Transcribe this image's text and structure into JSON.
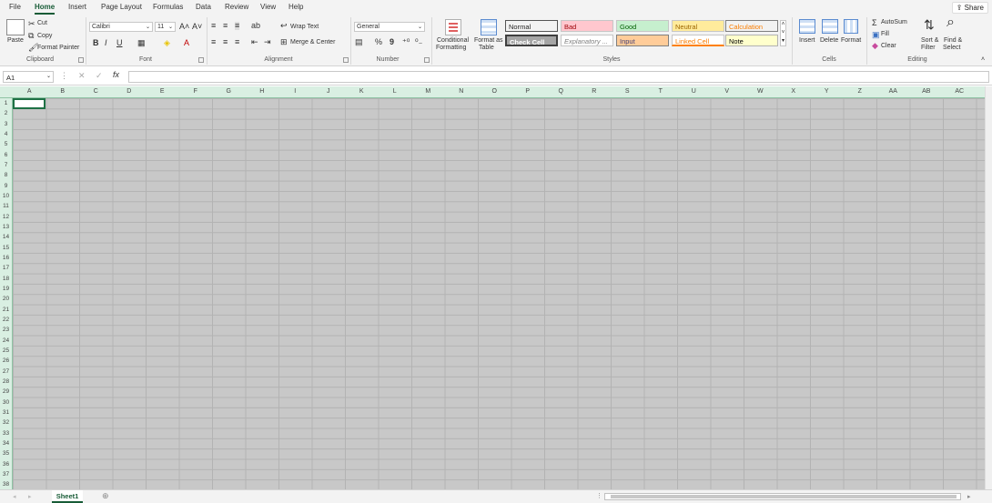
{
  "menu": {
    "tabs": [
      "File",
      "Home",
      "Insert",
      "Page Layout",
      "Formulas",
      "Data",
      "Review",
      "View",
      "Help"
    ],
    "share": "Share"
  },
  "clipboard": {
    "paste": "Paste",
    "cut": "Cut",
    "copy": "Copy",
    "format_painter": "Format Painter",
    "label": "Clipboard"
  },
  "font": {
    "name": "Calibri",
    "size": "11",
    "label": "Font",
    "bold": "B",
    "italic": "I",
    "underline": "U"
  },
  "alignment": {
    "wrap": "Wrap Text",
    "merge": "Merge & Center",
    "label": "Alignment"
  },
  "number": {
    "format": "General",
    "label": "Number",
    "percent": "%",
    "comma": "9"
  },
  "styles": {
    "conditional": "Conditional",
    "formatting": "Formatting",
    "format_as": "Format as",
    "table": "Table",
    "label": "Styles",
    "cells": [
      {
        "text": "Normal",
        "bg": "#ffffff",
        "fg": "#000000"
      },
      {
        "text": "Bad",
        "bg": "#ffc7ce",
        "fg": "#9c0006"
      },
      {
        "text": "Good",
        "bg": "#c6efce",
        "fg": "#006100"
      },
      {
        "text": "Neutral",
        "bg": "#ffeb9c",
        "fg": "#9c6500"
      },
      {
        "text": "Calculation",
        "bg": "#f2f2f2",
        "fg": "#fa7d00"
      },
      {
        "text": "Check Cell",
        "bg": "#a5a5a5",
        "fg": "#ffffff"
      },
      {
        "text": "Explanatory ...",
        "bg": "#ffffff",
        "fg": "#7f7f7f"
      },
      {
        "text": "Input",
        "bg": "#ffcc99",
        "fg": "#3f3f76"
      },
      {
        "text": "Linked Cell",
        "bg": "#ffffff",
        "fg": "#fa7d00"
      },
      {
        "text": "Note",
        "bg": "#ffffcc",
        "fg": "#000000"
      }
    ]
  },
  "cells_group": {
    "insert": "Insert",
    "delete": "Delete",
    "format": "Format",
    "label": "Cells"
  },
  "editing": {
    "autosum": "AutoSum",
    "fill": "Fill",
    "clear": "Clear",
    "sort": "Sort &",
    "filter": "Filter",
    "find": "Find &",
    "select": "Select",
    "label": "Editing"
  },
  "formula": {
    "namebox": "A1",
    "fx": "fx"
  },
  "columns": [
    "A",
    "B",
    "C",
    "D",
    "E",
    "F",
    "G",
    "H",
    "I",
    "J",
    "K",
    "L",
    "M",
    "N",
    "O",
    "P",
    "Q",
    "R",
    "S",
    "T",
    "U",
    "V",
    "W",
    "X",
    "Y",
    "Z",
    "AA",
    "AB",
    "AC"
  ],
  "rows": [
    "1",
    "2",
    "3",
    "4",
    "5",
    "6",
    "7",
    "8",
    "9",
    "10",
    "11",
    "12",
    "13",
    "14",
    "15",
    "16",
    "17",
    "18",
    "19",
    "20",
    "21",
    "22",
    "23",
    "24",
    "25",
    "26",
    "27",
    "28",
    "29",
    "30",
    "31",
    "32",
    "33",
    "34",
    "35",
    "36",
    "37",
    "38"
  ],
  "sheet": {
    "name": "Sheet1"
  },
  "colors": {
    "accent": "#185c37",
    "header_bg": "#d9efe2",
    "cell_bg": "#c8c8c8"
  }
}
